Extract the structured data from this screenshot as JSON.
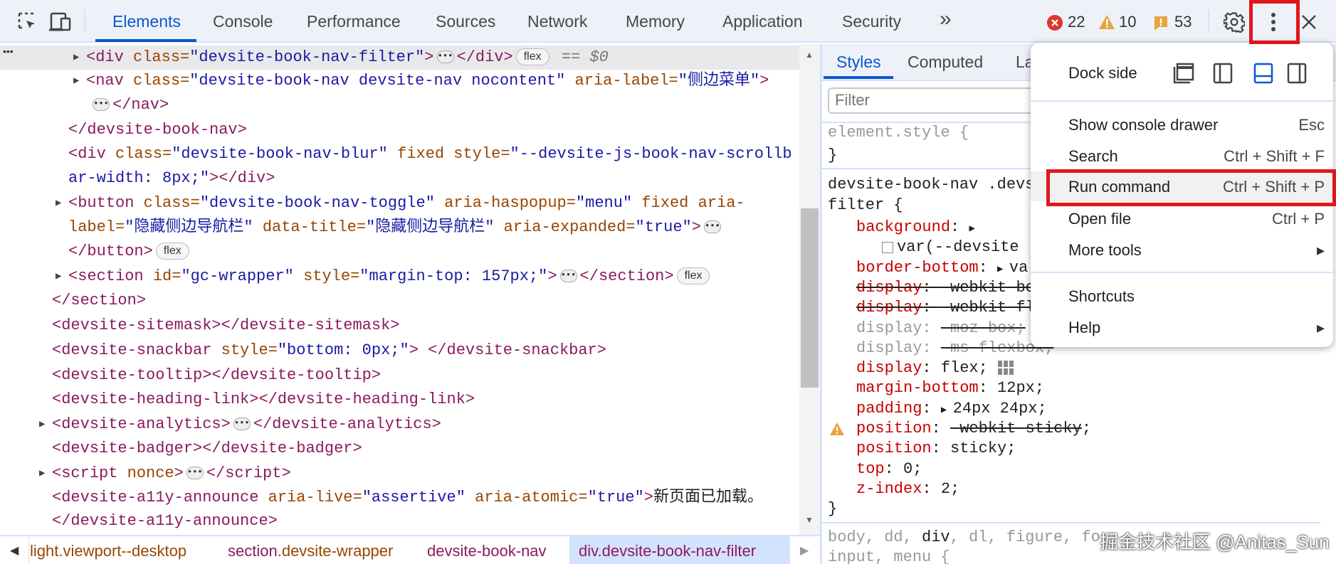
{
  "toolbar": {
    "tabs": [
      "Elements",
      "Console",
      "Performance",
      "Sources",
      "Network",
      "Memory",
      "Application",
      "Security"
    ],
    "more_tabs": "»",
    "errors": "22",
    "warnings": "10",
    "issues": "53",
    "colors": {
      "accent": "#0b57d0",
      "error": "#dc362e",
      "warning": "#e37400",
      "highlight_box": "#e0161d"
    }
  },
  "elements": {
    "gutter": "•••",
    "lines": [
      {
        "exp": true,
        "sel": true,
        "tok": [
          [
            "t",
            "<div "
          ],
          [
            "a",
            "class="
          ],
          [
            "v",
            "\"devsite-book-nav-filter\""
          ],
          [
            "t",
            ">"
          ],
          [
            "e",
            "•••"
          ],
          [
            "t",
            "</div>"
          ],
          [
            "b",
            "flex"
          ],
          [
            "s",
            " == $0"
          ]
        ]
      },
      {
        "exp": true,
        "tok": [
          [
            "t",
            "<nav "
          ],
          [
            "a",
            "class="
          ],
          [
            "v",
            "\"devsite-book-nav devsite-nav nocontent\""
          ],
          [
            "a",
            " aria-label="
          ],
          [
            "v",
            "\"侧边菜单\""
          ],
          [
            "t",
            ">"
          ]
        ]
      },
      {
        "tok": [
          [
            "e",
            "•••"
          ],
          [
            "t",
            "</nav>"
          ]
        ]
      },
      {
        "tok": [
          [
            "t",
            "</devsite-book-nav>"
          ]
        ]
      },
      {
        "tok": [
          [
            "t",
            "<div "
          ],
          [
            "a",
            "class="
          ],
          [
            "v",
            "\"devsite-book-nav-blur\""
          ],
          [
            "a",
            " fixed style="
          ],
          [
            "v",
            "\"--devsite-js-book-nav-scrollb"
          ]
        ]
      },
      {
        "tok": [
          [
            "v",
            "ar-width: 8px;\""
          ],
          [
            "t",
            "></div>"
          ]
        ]
      },
      {
        "exp": true,
        "tok": [
          [
            "t",
            "<button "
          ],
          [
            "a",
            "class="
          ],
          [
            "v",
            "\"devsite-book-nav-toggle\""
          ],
          [
            "a",
            " aria-haspopup="
          ],
          [
            "v",
            "\"menu\""
          ],
          [
            "a",
            " fixed aria-"
          ]
        ]
      },
      {
        "tok": [
          [
            "a",
            "label="
          ],
          [
            "v",
            "\"隐藏侧边导航栏\""
          ],
          [
            "a",
            " data-title="
          ],
          [
            "v",
            "\"隐藏侧边导航栏\""
          ],
          [
            "a",
            " aria-expanded="
          ],
          [
            "v",
            "\"true\""
          ],
          [
            "t",
            ">"
          ],
          [
            "e",
            "•••"
          ]
        ]
      },
      {
        "tok": [
          [
            "t",
            "</button>"
          ],
          [
            "b",
            "flex"
          ]
        ]
      },
      {
        "exp": true,
        "tok": [
          [
            "t",
            "<section "
          ],
          [
            "a",
            "id="
          ],
          [
            "v",
            "\"gc-wrapper\""
          ],
          [
            "a",
            " style="
          ],
          [
            "v",
            "\"margin-top: 157px;\""
          ],
          [
            "t",
            ">"
          ],
          [
            "e",
            "•••"
          ],
          [
            "t",
            "</section>"
          ],
          [
            "b",
            "flex"
          ]
        ]
      },
      {
        "tok": [
          [
            "t",
            "</section>"
          ]
        ]
      },
      {
        "tok": [
          [
            "t",
            "<devsite-sitemask></devsite-sitemask>"
          ]
        ]
      },
      {
        "tok": [
          [
            "t",
            "<devsite-snackbar "
          ],
          [
            "a",
            "style="
          ],
          [
            "v",
            "\"bottom: 0px;\""
          ],
          [
            "t",
            "> </devsite-snackbar>"
          ]
        ]
      },
      {
        "tok": [
          [
            "t",
            "<devsite-tooltip></devsite-tooltip>"
          ]
        ]
      },
      {
        "tok": [
          [
            "t",
            "<devsite-heading-link></devsite-heading-link>"
          ]
        ]
      },
      {
        "exp": true,
        "tok": [
          [
            "t",
            "<devsite-analytics>"
          ],
          [
            "e",
            "•••"
          ],
          [
            "t",
            "</devsite-analytics>"
          ]
        ]
      },
      {
        "tok": [
          [
            "t",
            "<devsite-badger></devsite-badger>"
          ]
        ]
      },
      {
        "exp": true,
        "tok": [
          [
            "t",
            "<script "
          ],
          [
            "a",
            "nonce"
          ],
          [
            "t",
            ">"
          ],
          [
            "e",
            "•••"
          ],
          [
            "t",
            "</script>"
          ]
        ]
      },
      {
        "tok": [
          [
            "t",
            "<devsite-a11y-announce "
          ],
          [
            "a",
            "aria-live="
          ],
          [
            "v",
            "\"assertive\""
          ],
          [
            "a",
            " aria-atomic="
          ],
          [
            "v",
            "\"true\""
          ],
          [
            "t",
            ">"
          ],
          [
            "x",
            "新页面已加载。"
          ]
        ]
      },
      {
        "tok": [
          [
            "t",
            "</devsite-a11y-announce>"
          ]
        ]
      }
    ]
  },
  "breadcrumbs": [
    {
      "tag": "light.viewport--desktop",
      "cls": ""
    },
    {
      "tag": "section",
      "cls": ".devsite-wrapper"
    },
    {
      "tag": "devsite-book-nav",
      "cls": ""
    },
    {
      "tag": "div",
      "cls": ".devsite-book-nav-filter"
    }
  ],
  "styles": {
    "tabs": [
      "Styles",
      "Computed",
      "La"
    ],
    "filter_placeholder": "Filter",
    "element_style": "element.style {",
    "close_brace": "}",
    "selector": "devsite-book-nav .devs",
    "selector2": "filter {",
    "decls": [
      {
        "n": "background",
        "v": "",
        "arrow": true
      },
      {
        "n": "",
        "v": "var(--devsite",
        "swatch": true
      },
      {
        "n": "border-bottom",
        "v": "va",
        "arrow": true
      },
      {
        "n": "display",
        "v": "-webkit-bo",
        "over": true
      },
      {
        "n": "display",
        "v": "-webkit-fl",
        "over": true
      },
      {
        "n": "display",
        "v": "-moz-box;",
        "invalid": true
      },
      {
        "n": "display",
        "v": "-ms-flexbox;",
        "invalid": true
      },
      {
        "n": "display",
        "v": "flex;",
        "grid": true
      },
      {
        "n": "margin-bottom",
        "v": "12px;"
      },
      {
        "n": "padding",
        "v": "24px 24px;",
        "arrow": true
      },
      {
        "n": "position",
        "v": "-webkit-sticky",
        "warn": true,
        "strikeval": true
      },
      {
        "n": "position",
        "v": "sticky;"
      },
      {
        "n": "top",
        "v": "0;"
      },
      {
        "n": "z-index",
        "v": "2;"
      }
    ],
    "next_rule": [
      "body, dd, ",
      "div",
      ", dl, figure, fo"
    ],
    "next_rule2": "input, menu {"
  },
  "menu": {
    "dock_side": "Dock side",
    "dock_options": [
      "undock",
      "dock-left",
      "dock-bottom",
      "dock-right"
    ],
    "dock_selected": "dock-bottom",
    "items": [
      {
        "label": "Show console drawer",
        "shortcut": "Esc"
      },
      {
        "label": "Search",
        "shortcut": "Ctrl + Shift + F"
      },
      {
        "label": "Run command",
        "shortcut": "Ctrl + Shift + P"
      },
      {
        "label": "Open file",
        "shortcut": "Ctrl + P"
      },
      {
        "label": "More tools",
        "shortcut": "▸"
      }
    ],
    "items2": [
      {
        "label": "Shortcuts",
        "shortcut": ""
      },
      {
        "label": "Help",
        "shortcut": "▸"
      }
    ]
  },
  "watermark": "掘金技术社区 @Anitas_Sun"
}
